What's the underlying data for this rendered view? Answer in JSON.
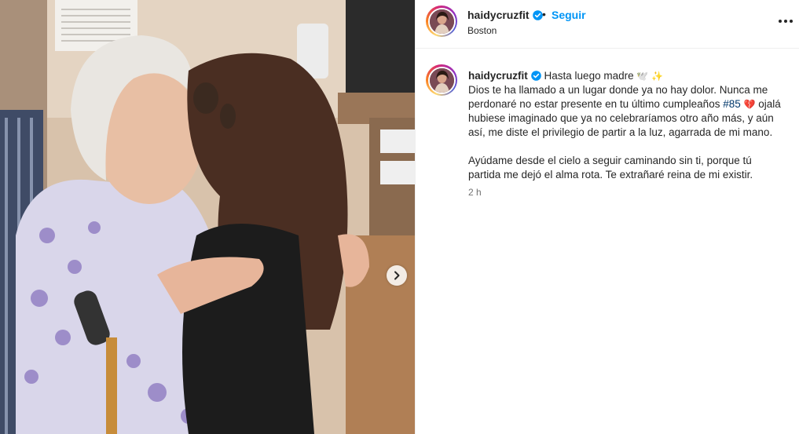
{
  "post": {
    "username": "haidycruzfit",
    "separator": "•",
    "follow_label": "Seguir",
    "location": "Boston",
    "more_icon": "more-options-icon",
    "caption_title": "Hasta luego madre",
    "caption_title_emojis": "🕊️ ✨",
    "caption_line1": "Dios te ha llamado a un lugar donde ya no hay dolor. Nunca me perdonaré no estar presente en tu último cumpleaños",
    "hashtag": "#85",
    "heart_emoji": "💔",
    "caption_line1_end": "ojalá hubiese imaginado que ya no celebraríamos otro año más, y aún así, me diste el privilegio de partir a la luz, agarrada de mi mano.",
    "caption_para2": "Ayúdame desde el cielo a seguir caminando sin ti, porque tú partida me dejó el alma rota. Te extrañaré reina de mi existir.",
    "time": "2 h"
  },
  "colors": {
    "follow": "#0095f6",
    "hashtag": "#00376b",
    "verified": "#0095f6",
    "muted": "#737373"
  }
}
